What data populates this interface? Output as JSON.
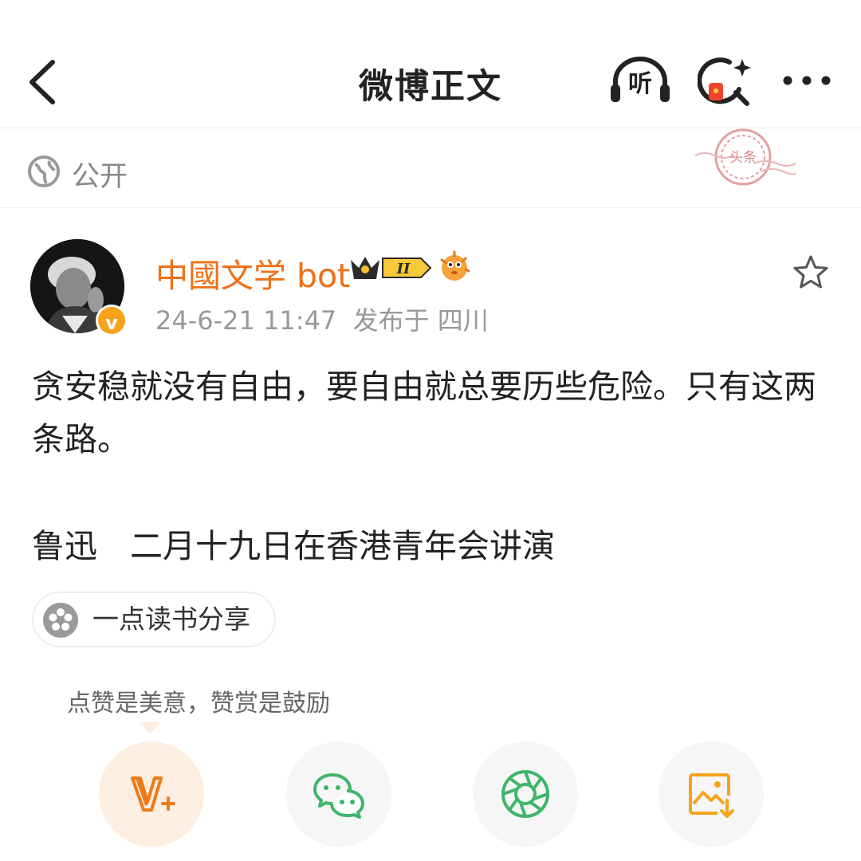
{
  "header": {
    "title": "微博正文",
    "listen_label": "听"
  },
  "visibility": {
    "label": "公开"
  },
  "stamp": {
    "text": "头条"
  },
  "author": {
    "name": "中國文学 bot",
    "verified_mark": "v",
    "level_badge": "II",
    "time": "24-6-21 11:47",
    "location": "发布于 四川"
  },
  "post": {
    "paragraphs": [
      "贪安稳就没有自由，要自由就总要历些危险。只有这两条路。",
      "鲁迅　二月十九日在香港青年会讲演"
    ]
  },
  "topic_tag": {
    "label": "一点读书分享"
  },
  "reward_hint": "点赞是美意，赞赏是鼓励",
  "share_actions": [
    {
      "name": "weibo-plus",
      "icon": "v-plus-icon",
      "color": "#f07a16"
    },
    {
      "name": "wechat",
      "icon": "wechat-icon",
      "color": "#3fb56b"
    },
    {
      "name": "moments",
      "icon": "camera-aperture-icon",
      "color": "#3fb56b"
    },
    {
      "name": "save-image",
      "icon": "save-image-icon",
      "color": "#f6a31b"
    }
  ],
  "colors": {
    "accent": "#f07016",
    "meta": "#999999",
    "text": "#222222"
  }
}
